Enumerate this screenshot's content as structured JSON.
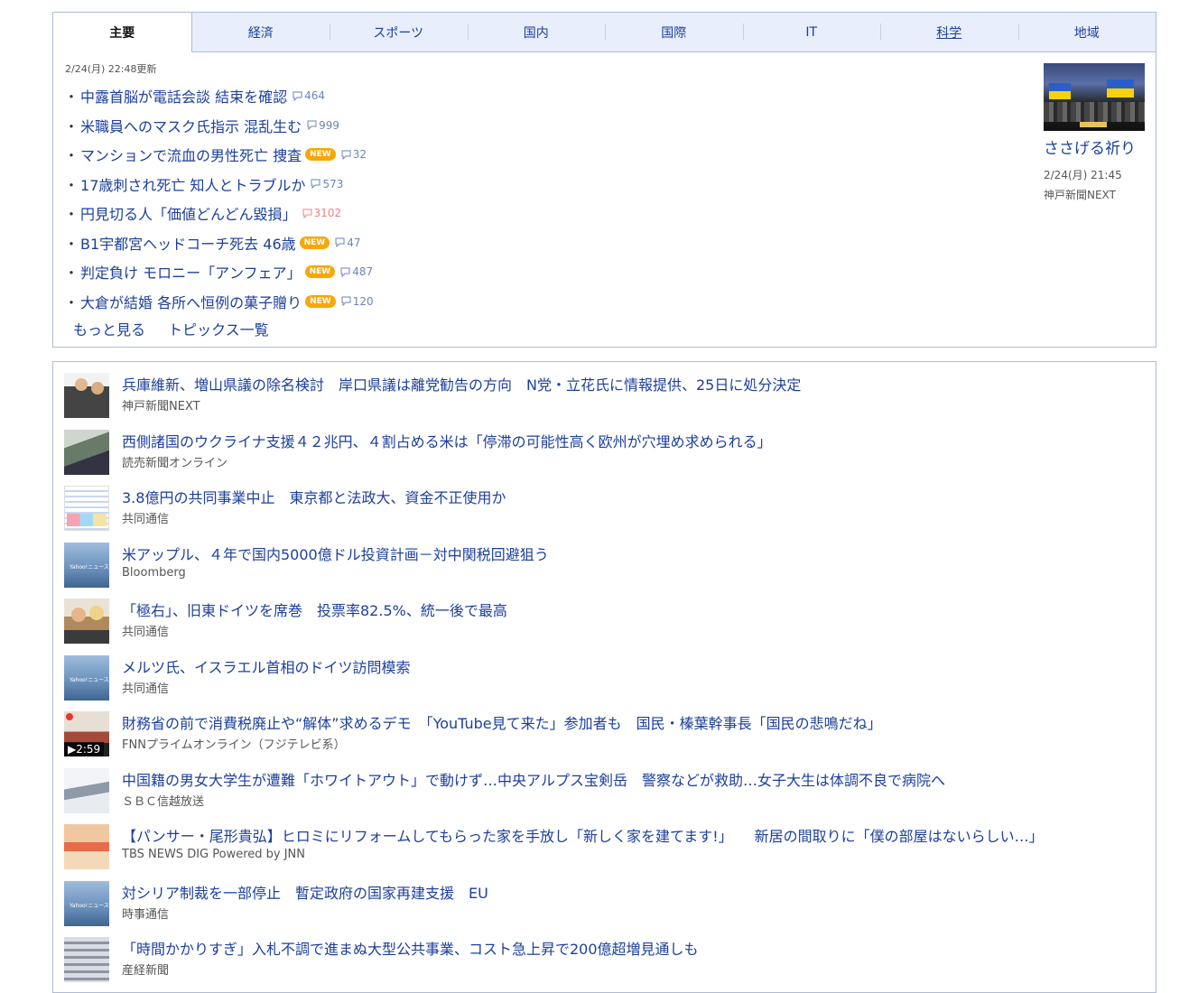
{
  "tabs": [
    "主要",
    "経済",
    "スポーツ",
    "国内",
    "国際",
    "IT",
    "科学",
    "地域"
  ],
  "active_tab": 0,
  "updated": "2/24(月) 22:48更新",
  "topics": [
    {
      "title": "中露首脳が電話会談 結束を確認",
      "is_new": false,
      "comments": "464"
    },
    {
      "title": "米職員へのマスク氏指示 混乱生む",
      "is_new": false,
      "comments": "999"
    },
    {
      "title": "マンションで流血の男性死亡 捜査",
      "is_new": true,
      "comments": "32"
    },
    {
      "title": "17歳刺され死亡 知人とトラブルか",
      "is_new": false,
      "comments": "573"
    },
    {
      "title": "円見切る人「価値どんどん毀損」",
      "is_new": false,
      "comments": "3102",
      "hot": true
    },
    {
      "title": "B1宇都宮ヘッドコーチ死去 46歳",
      "is_new": true,
      "comments": "47"
    },
    {
      "title": "判定負け モロニー「アンフェア」",
      "is_new": true,
      "comments": "487"
    },
    {
      "title": "大倉が結婚 各所へ恒例の菓子贈り",
      "is_new": true,
      "comments": "120"
    }
  ],
  "new_label": "NEW",
  "more_links": [
    "もっと見る",
    "トピックス一覧"
  ],
  "pickup": {
    "title": "ささげる祈り",
    "date": "2/24(月) 21:45",
    "source": "神戸新聞NEXT"
  },
  "news": [
    {
      "title": "兵庫維新、増山県議の除名検討　岸口県議は離党勧告の方向　N党・立花氏に情報提供、25日に処分決定",
      "source": "神戸新聞NEXT",
      "thumb": "th-people"
    },
    {
      "title": "西側諸国のウクライナ支援４２兆円、４割占める米は「停滞の可能性高く欧州が穴埋め求められる」",
      "source": "読売新聞オンライン",
      "thumb": "th-street"
    },
    {
      "title": "3.8億円の共同事業中止　東京都と法政大、資金不正使用か",
      "source": "共同通信",
      "thumb": "th-doc"
    },
    {
      "title": "米アップル、４年で国内5000億ドル投資計画－対中関税回避狙う",
      "source": "Bloomberg",
      "thumb": "th-yahoo"
    },
    {
      "title": "「極右」、旧東ドイツを席巻　投票率82.5%、統一後で最高",
      "source": "共同通信",
      "thumb": "th-rally"
    },
    {
      "title": "メルツ氏、イスラエル首相のドイツ訪問模索",
      "source": "共同通信",
      "thumb": "th-yahoo"
    },
    {
      "title": "財務省の前で消費税廃止や“解体”求めるデモ　「YouTube見て来た」参加者も　国民・榛葉幹事長「国民の悲鳴だね」",
      "source": "FNNプライムオンライン（フジテレビ系）",
      "thumb": "th-video",
      "video": "▶2:59"
    },
    {
      "title": "中国籍の男女大学生が遭難「ホワイトアウト」で動けず…中央アルプス宝剣岳　警察などが救助…女子大生は体調不良で病院へ",
      "source": "ＳＢＣ信越放送",
      "thumb": "th-snow"
    },
    {
      "title": "【パンサー・尾形貴弘】ヒロミにリフォームしてもらった家を手放し「新しく家を建てます!」　　新居の間取りに「僕の部屋はないらしい…」",
      "source": "TBS NEWS DIG Powered by JNN",
      "thumb": "th-tv"
    },
    {
      "title": "対シリア制裁を一部停止　暫定政府の国家再建支援　EU",
      "source": "時事通信",
      "thumb": "th-yahoo"
    },
    {
      "title": "「時間かかりすぎ」入札不調で進まぬ大型公共事業、コスト急上昇で200億超増見通しも",
      "source": "産経新聞",
      "thumb": "th-train"
    }
  ]
}
